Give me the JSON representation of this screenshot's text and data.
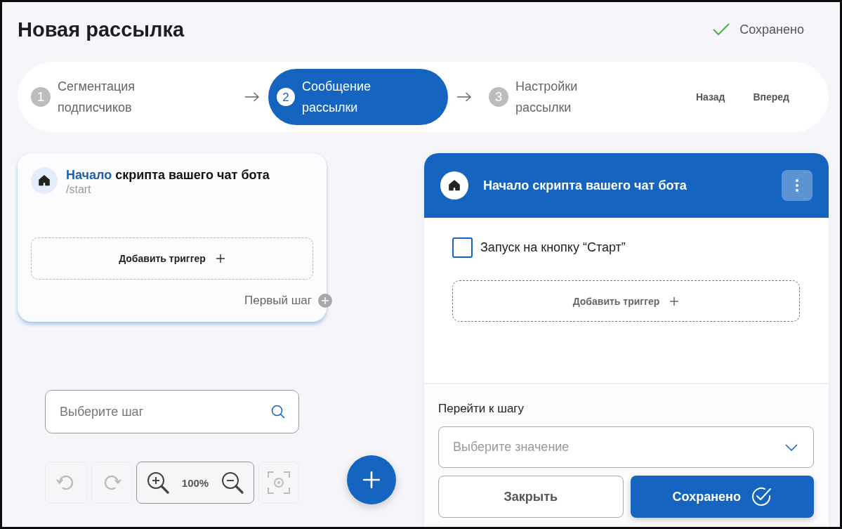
{
  "page": {
    "title": "Новая рассылка",
    "save_status": "Сохранено"
  },
  "stepper": {
    "steps": [
      {
        "number": "1",
        "label": "Сегментация подписчиков",
        "selected": false
      },
      {
        "number": "2",
        "label": "Сообщение рассылки",
        "selected": true
      },
      {
        "number": "3",
        "label": "Настройки рассылки",
        "selected": false
      }
    ],
    "back_button": "Назад",
    "forward_button": "Вперед"
  },
  "canvas": {
    "start_node": {
      "title_accent": "Начало",
      "title": "скрипта вашего чат бота",
      "command": "/start",
      "add_trigger": "Добавить триггер",
      "next_step": "Первый шаг"
    },
    "step_search": {
      "placeholder": "Выберите шаг"
    },
    "toolbar": [
      {
        "kind": "undo",
        "disabled": true
      },
      {
        "kind": "redo",
        "disabled": true
      },
      {
        "kind": "zoom",
        "reading": "100%"
      },
      {
        "kind": "fit",
        "disabled": true
      }
    ]
  },
  "editor": {
    "title": "Начало скрипта вашего чат бота",
    "start_button_trigger": {
      "label": "Запуск на кнопку “Старт”",
      "checked": false
    },
    "add_trigger": "Добавить триггер",
    "goto_step": {
      "label": "Перейти к шагу",
      "placeholder": "Выберите значение"
    },
    "close_button": "Закрыть",
    "save_button": "Сохранено"
  }
}
